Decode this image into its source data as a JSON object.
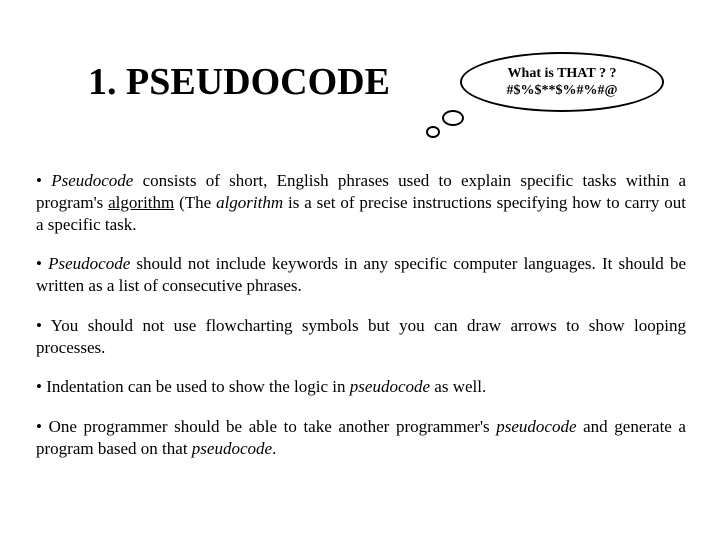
{
  "title": "1. PSEUDOCODE",
  "bubble": {
    "line1": "What is THAT ? ?",
    "line2": "#$%$**$%#%#@"
  },
  "bullets": {
    "b1": {
      "t1": "Pseudocode",
      "t2": " consists of short, English phrases used to explain specific tasks within a program's ",
      "t3": "algorithm",
      "t4": " (The ",
      "t5": "algorithm",
      "t6": " is a set of precise instructions specifying how to carry out a specific task."
    },
    "b2": {
      "t1": "Pseudocode",
      "t2": " should not include keywords in any specific computer languages. It should be written as a list of consecutive phrases."
    },
    "b3": {
      "t1": "You should not use flowcharting symbols but you can draw arrows to show looping processes."
    },
    "b4": {
      "t1": "Indentation can be used to show the logic in ",
      "t2": "pseudocode",
      "t3": " as well."
    },
    "b5": {
      "t1": "One programmer should be able to take another programmer's ",
      "t2": "pseudocode",
      "t3": " and generate a program based on that ",
      "t4": "pseudocode",
      "t5": "."
    }
  }
}
